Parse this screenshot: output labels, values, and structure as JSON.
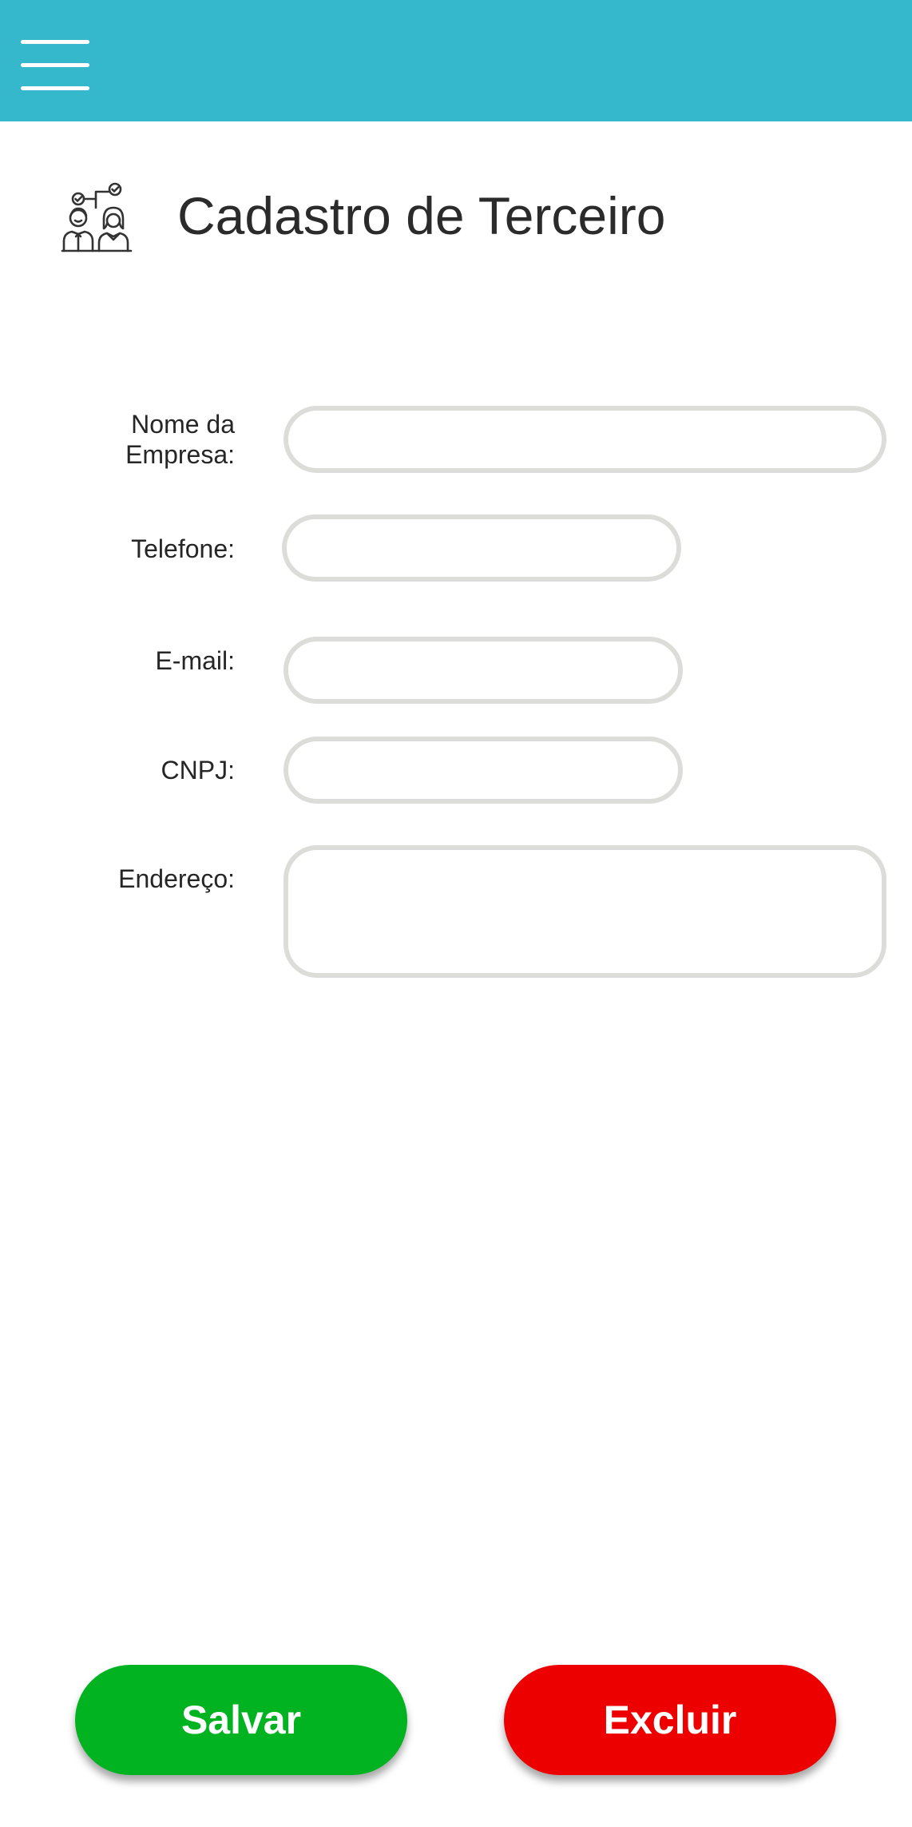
{
  "header": {
    "menu_icon": "hamburger-menu-icon",
    "bar_color": "#36b8cc"
  },
  "page": {
    "icon": "people-checklist-icon",
    "title": "Cadastro de Terceiro"
  },
  "form": {
    "company_name_label_line1": "Nome da",
    "company_name_label_line2": "Empresa:",
    "company_name_value": "",
    "phone_label": "Telefone:",
    "phone_value": "",
    "email_label": "E-mail:",
    "email_value": "",
    "cnpj_label": "CNPJ:",
    "cnpj_value": "",
    "address_label": "Endereço:",
    "address_value": ""
  },
  "actions": {
    "save_label": "Salvar",
    "save_color": "#02b321",
    "delete_label": "Excluir",
    "delete_color": "#ec0000"
  }
}
